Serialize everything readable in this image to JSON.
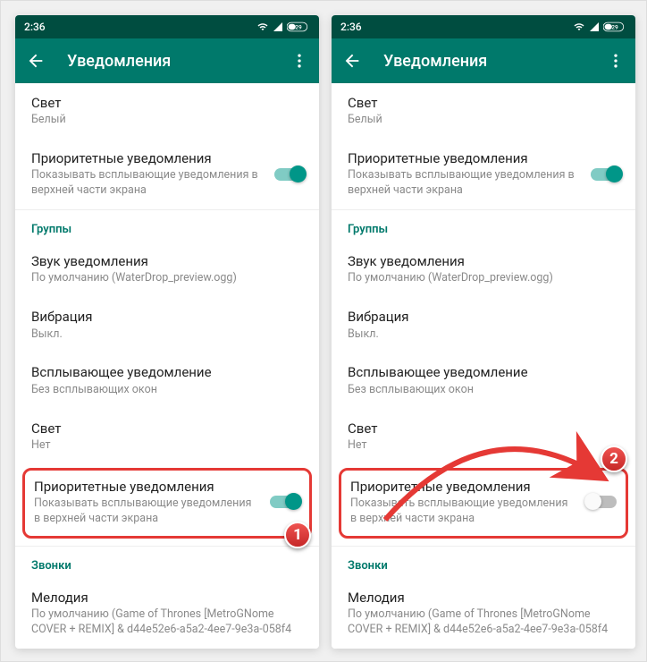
{
  "status": {
    "time": "2:36",
    "battery": "29"
  },
  "app_bar": {
    "title": "Уведомления"
  },
  "light": {
    "label": "Свет",
    "value": "Белый"
  },
  "priority_top": {
    "label": "Приоритетные уведомления",
    "sub": "Показывать всплывающие уведомления в верхней части экрана"
  },
  "sections": {
    "groups": "Группы",
    "calls": "Звонки"
  },
  "g_sound": {
    "label": "Звук уведомления",
    "value": "По умолчанию (WaterDrop_preview.ogg)"
  },
  "g_vibration": {
    "label": "Вибрация",
    "value": "Выкл."
  },
  "g_popup": {
    "label": "Всплывающее уведомление",
    "value": "Без всплывающих окон"
  },
  "g_light": {
    "label": "Свет",
    "value": "Нет"
  },
  "g_priority": {
    "label": "Приоритетные уведомления",
    "sub": "Показывать всплывающие уведомления в верхней части экрана"
  },
  "c_ringtone": {
    "label": "Мелодия",
    "value": "По умолчанию (Game of Thrones [MetroGNome COVER + REMIX] & d44e52e6-a5a2-4ee7-9e3a-058f4"
  },
  "badges": {
    "one": "1",
    "two": "2"
  }
}
